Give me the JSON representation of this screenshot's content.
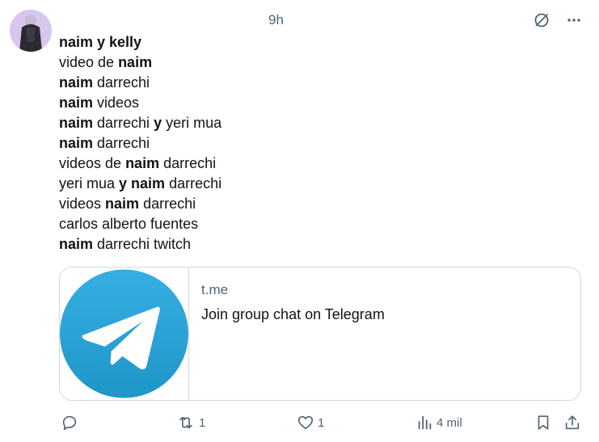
{
  "post": {
    "timestamp": "9h",
    "lines": [
      [
        {
          "t": "naim y kelly",
          "b": true
        }
      ],
      [
        {
          "t": "video de ",
          "b": false
        },
        {
          "t": "naim",
          "b": true
        }
      ],
      [
        {
          "t": "naim",
          "b": true
        },
        {
          "t": " darrechi",
          "b": false
        }
      ],
      [
        {
          "t": "naim",
          "b": true
        },
        {
          "t": " videos",
          "b": false
        }
      ],
      [
        {
          "t": "naim",
          "b": true
        },
        {
          "t": " darrechi ",
          "b": false
        },
        {
          "t": "y",
          "b": true
        },
        {
          "t": " yeri mua",
          "b": false
        }
      ],
      [
        {
          "t": "naim",
          "b": true
        },
        {
          "t": " darrechi",
          "b": false
        }
      ],
      [
        {
          "t": "videos de ",
          "b": false
        },
        {
          "t": "naim",
          "b": true
        },
        {
          "t": " darrechi",
          "b": false
        }
      ],
      [
        {
          "t": "yeri mua ",
          "b": false
        },
        {
          "t": "y naim",
          "b": true
        },
        {
          "t": " darrechi",
          "b": false
        }
      ],
      [
        {
          "t": "videos ",
          "b": false
        },
        {
          "t": "naim",
          "b": true
        },
        {
          "t": " darrechi",
          "b": false
        }
      ],
      [
        {
          "t": "carlos alberto fuentes",
          "b": false
        }
      ],
      [
        {
          "t": "naim",
          "b": true
        },
        {
          "t": " darrechi twitch",
          "b": false
        }
      ]
    ]
  },
  "card": {
    "domain": "t.me",
    "title": "Join group chat on Telegram",
    "brand_color": "#2aa3e2"
  },
  "actions": {
    "reposts": "1",
    "likes": "1",
    "views": "4 mil"
  },
  "icons": {
    "top": [
      "grok-icon",
      "more-icon"
    ],
    "bottom": [
      "reply-icon",
      "repost-icon",
      "like-icon",
      "views-icon",
      "bookmark-icon",
      "share-icon"
    ]
  },
  "colors": {
    "text": "#0f1419",
    "muted": "#536471",
    "border": "#cfd9de"
  }
}
